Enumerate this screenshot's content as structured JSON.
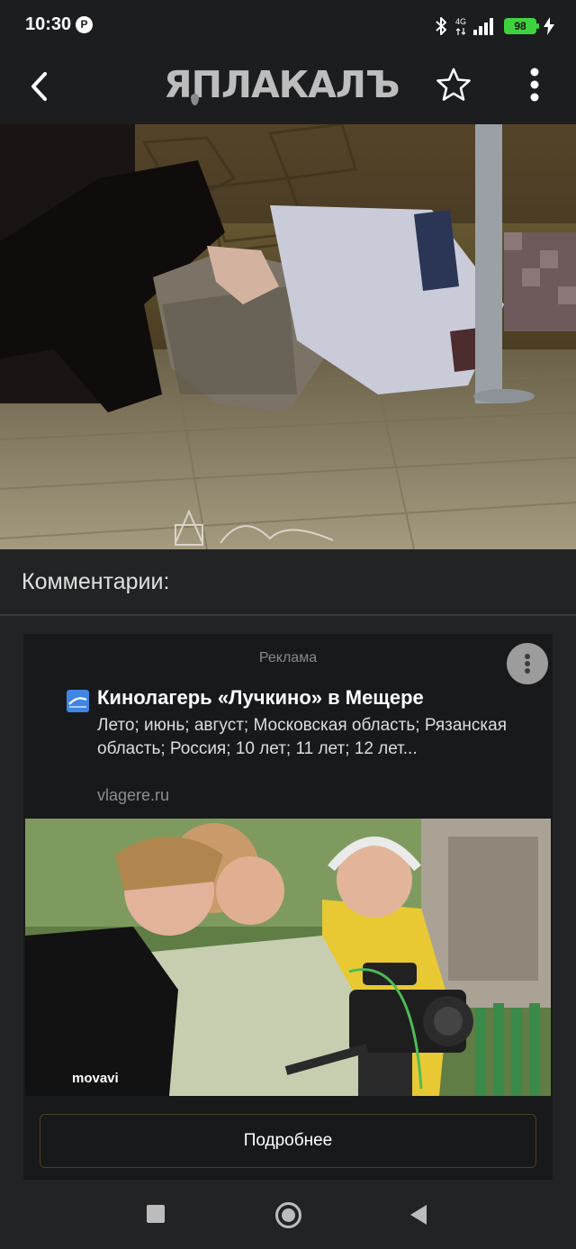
{
  "status_bar": {
    "time": "10:30",
    "notification_badge": "P",
    "network_label": "4G",
    "battery": "98",
    "battery_color": "#3ed33e"
  },
  "app_bar": {
    "logo_text": "ЯПЛАКАЛЪ",
    "icons": [
      "back-arrow-icon",
      "star-outline-icon",
      "more-vertical-icon"
    ]
  },
  "article": {
    "image_description": "photo"
  },
  "comments": {
    "title": "Комментарии:"
  },
  "ad": {
    "label": "Реклама",
    "title": "Кинолагерь «Лучкино» в Мещере",
    "description": "Лето; июнь; август; Московская область; Рязанская область; Россия; 10 лет; 11 лет; 12 лет...",
    "domain": "vlagere.ru",
    "button_label": "Подробнее",
    "image_watermark": "movavi",
    "button_border_color": "#4b3f1d"
  },
  "nav_bar": {
    "icons": [
      "recent-apps-icon",
      "home-icon",
      "back-triangle-icon"
    ]
  }
}
